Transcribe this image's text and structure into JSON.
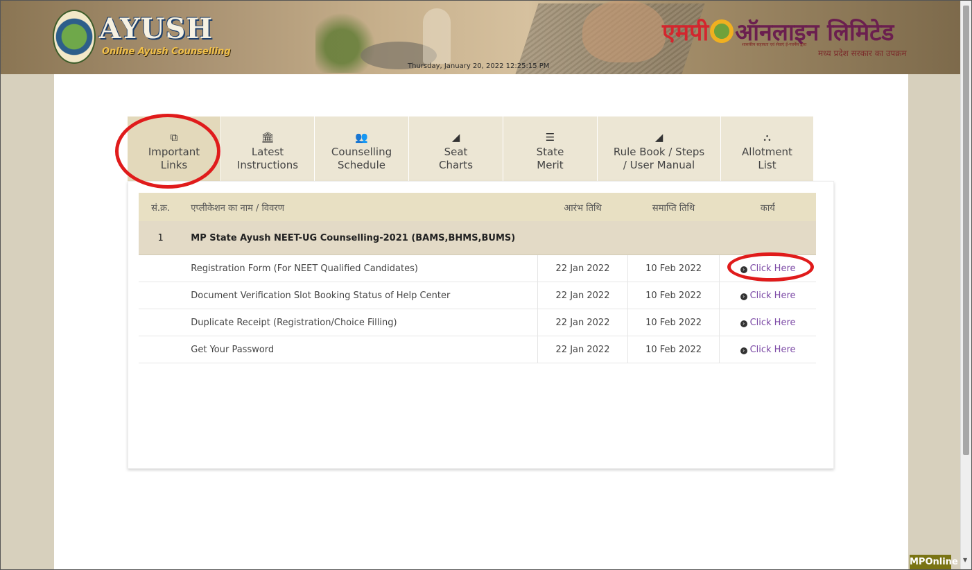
{
  "header": {
    "brand_title": "AYUSH",
    "brand_subtitle": "Online Ayush Counselling",
    "datetime": "Thursday, January 20, 2022 12:25:15 PM",
    "mp_brand_a": "एमपी",
    "mp_brand_b": "ऑनलाइन लिमिटेड",
    "mp_tag_small": "शासकीय सहायता एवं सेवाएं ई-गवर्नेंस द्वारा",
    "mp_tag": "मध्य प्रदेश सरकार का उपक्रम"
  },
  "tabs": [
    {
      "icon": "external-link-icon",
      "glyph": "⧉",
      "label": "Important\nLinks",
      "active": true
    },
    {
      "icon": "institution-icon",
      "glyph": "🏛",
      "label": "Latest\nInstructions",
      "active": false
    },
    {
      "icon": "users-icon",
      "glyph": "👥",
      "label": "Counselling\nSchedule",
      "active": false
    },
    {
      "icon": "area-chart-icon",
      "glyph": "◢",
      "label": "Seat\nCharts",
      "active": false
    },
    {
      "icon": "list-ol-icon",
      "glyph": "☰",
      "label": "State\nMerit",
      "active": false
    },
    {
      "icon": "area-chart-icon",
      "glyph": "◢",
      "label": "Rule Book / Steps\n/ User Manual",
      "active": false
    },
    {
      "icon": "sitemap-icon",
      "glyph": "⛬",
      "label": "Allotment\nList",
      "active": false
    }
  ],
  "table": {
    "headers": {
      "sr": "सं.क्र.",
      "name": "एप्लीकेशन का नाम / विवरण",
      "start": "आरंभ तिथि",
      "end": "समाप्ति तिथि",
      "action": "कार्य"
    },
    "group": {
      "sr": "1",
      "title": "MP State Ayush NEET-UG Counselling-2021 (BAMS,BHMS,BUMS)"
    },
    "rows": [
      {
        "name": "Registration Form (For NEET Qualified Candidates)",
        "start": "22 Jan 2022",
        "end": "10 Feb 2022",
        "action": "Click Here"
      },
      {
        "name": "Document Verification Slot Booking Status of Help Center",
        "start": "22 Jan 2022",
        "end": "10 Feb 2022",
        "action": "Click Here"
      },
      {
        "name": "Duplicate Receipt (Registration/Choice Filling)",
        "start": "22 Jan 2022",
        "end": "10 Feb 2022",
        "action": "Click Here"
      },
      {
        "name": "Get Your Password",
        "start": "22 Jan 2022",
        "end": "10 Feb 2022",
        "action": "Click Here"
      }
    ]
  },
  "footer_badge": "MPOnline",
  "colors": {
    "accent_red": "#e01b1b",
    "link": "#7c4aa6",
    "tab_bg": "#ece6d4",
    "header_row": "#e8e0c3"
  }
}
